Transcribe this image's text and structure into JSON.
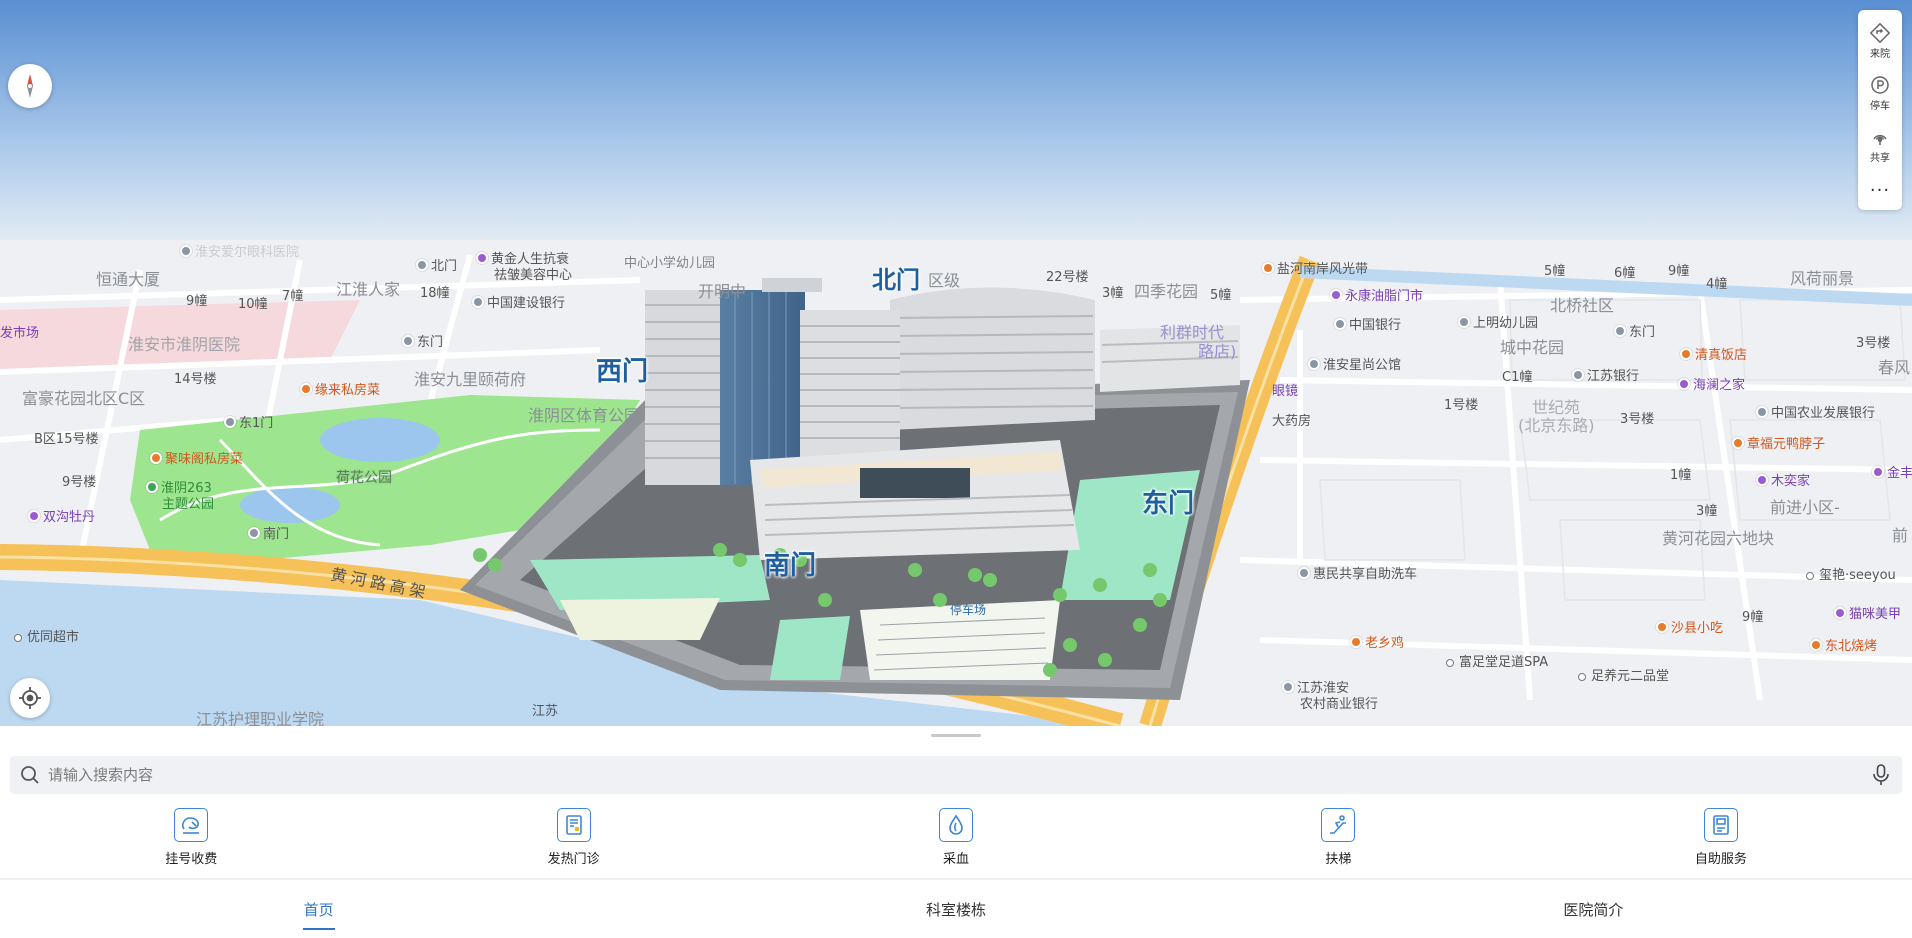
{
  "colors": {
    "accent": "#2f74c7",
    "icon_blue": "#3d86d6",
    "road_yellow": "#f5c158",
    "park_green": "#9ee58f",
    "water": "#bdd9f2"
  },
  "map": {
    "gates": {
      "north": "北门",
      "west": "西门",
      "south": "南门",
      "east": "东门",
      "parking": "停车场"
    },
    "roads": {
      "huanghe": "黄河路高架"
    },
    "labels": [
      {
        "text": "淮安爱尔眼科医院",
        "style": "faded"
      },
      {
        "text": "恒通大厦",
        "style": "big"
      },
      {
        "text": "北门"
      },
      {
        "text": "黄金人生抗衰"
      },
      {
        "text": "祛皱美容中心"
      },
      {
        "text": "中心小学幼儿园"
      },
      {
        "text": "开明中"
      },
      {
        "text": "江淮人家",
        "style": "big"
      },
      {
        "text": "9幢"
      },
      {
        "text": "10幢"
      },
      {
        "text": "7幢"
      },
      {
        "text": "18幢"
      },
      {
        "text": "中国建设银行"
      },
      {
        "text": "发市场",
        "style": "purple"
      },
      {
        "text": "淮安市淮阴医院",
        "style": "area"
      },
      {
        "text": "东门"
      },
      {
        "text": "14号楼"
      },
      {
        "text": "缘来私房菜",
        "style": "orange"
      },
      {
        "text": "淮安九里颐荷府",
        "style": "big"
      },
      {
        "text": "富豪花园北区C区",
        "style": "big"
      },
      {
        "text": "淮阴区体育公园",
        "style": "big"
      },
      {
        "text": "东1门"
      },
      {
        "text": "B区15号楼"
      },
      {
        "text": "聚味阁私房菜",
        "style": "orange"
      },
      {
        "text": "荷花公园",
        "style": "park"
      },
      {
        "text": "9号楼"
      },
      {
        "text": "淮阴263"
      },
      {
        "text": "主题公园"
      },
      {
        "text": "双沟牡丹",
        "style": "purple"
      },
      {
        "text": "南门"
      },
      {
        "text": "优同超市"
      },
      {
        "text": "江苏护理职业学院"
      },
      {
        "text": "江苏"
      },
      {
        "text": "区级"
      },
      {
        "text": "22号楼"
      },
      {
        "text": "3幢"
      },
      {
        "text": "四季花园",
        "style": "big"
      },
      {
        "text": "5幢"
      },
      {
        "text": "利群时代"
      },
      {
        "text": "路店)"
      },
      {
        "text": "眼镜"
      },
      {
        "text": "大药房"
      },
      {
        "text": "盐河南岸风光带"
      },
      {
        "text": "永康油脂门市",
        "style": "purple"
      },
      {
        "text": "中国银行"
      },
      {
        "text": "淮安星尚公馆"
      },
      {
        "text": "5幢"
      },
      {
        "text": "6幢"
      },
      {
        "text": "9幢"
      },
      {
        "text": "4幢"
      },
      {
        "text": "风荷丽景",
        "style": "big"
      },
      {
        "text": "北桥社区",
        "style": "big"
      },
      {
        "text": "上明幼儿园"
      },
      {
        "text": "东门"
      },
      {
        "text": "城中花园",
        "style": "big"
      },
      {
        "text": "清真饭店",
        "style": "orange"
      },
      {
        "text": "3号楼"
      },
      {
        "text": "C1幢"
      },
      {
        "text": "江苏银行"
      },
      {
        "text": "海澜之家",
        "style": "purple"
      },
      {
        "text": "春风",
        "style": "big"
      },
      {
        "text": "1号楼"
      },
      {
        "text": "世纪苑",
        "style": "area"
      },
      {
        "text": "(北京东路)",
        "style": "area"
      },
      {
        "text": "3号楼"
      },
      {
        "text": "中国农业发展银行"
      },
      {
        "text": "章福元鸭脖子",
        "style": "orange"
      },
      {
        "text": "1幢"
      },
      {
        "text": "木奕家",
        "style": "purple"
      },
      {
        "text": "金丰",
        "style": "purple"
      },
      {
        "text": "前进小区-",
        "style": "big"
      },
      {
        "text": "3幢"
      },
      {
        "text": "黄河花园六地块",
        "style": "big"
      },
      {
        "text": "前",
        "style": "big"
      },
      {
        "text": "惠民共享自助洗车"
      },
      {
        "text": "玺艳·seeyou"
      },
      {
        "text": "9幢"
      },
      {
        "text": "猫咪美甲",
        "style": "purple"
      },
      {
        "text": "沙县小吃",
        "style": "orange"
      },
      {
        "text": "老乡鸡",
        "style": "orange"
      },
      {
        "text": "东北烧烤",
        "style": "orange"
      },
      {
        "text": "富足堂足道SPA"
      },
      {
        "text": "足养元二品堂"
      },
      {
        "text": "江苏淮安"
      },
      {
        "text": "农村商业银行"
      }
    ]
  },
  "toolbox": [
    {
      "label": "来院",
      "icon": "route-icon"
    },
    {
      "label": "停车",
      "icon": "parking-icon"
    },
    {
      "label": "共享",
      "icon": "share-signal-icon"
    }
  ],
  "toolbox_more": "···",
  "search": {
    "placeholder": "请输入搜索内容"
  },
  "services": [
    {
      "label": "挂号收费",
      "icon": "registration-icon"
    },
    {
      "label": "发热门诊",
      "icon": "fever-clinic-icon"
    },
    {
      "label": "采血",
      "icon": "blood-drop-icon"
    },
    {
      "label": "扶梯",
      "icon": "escalator-icon"
    },
    {
      "label": "自助服务",
      "icon": "self-service-icon"
    }
  ],
  "tabs": [
    {
      "label": "首页",
      "active": true
    },
    {
      "label": "科室楼栋",
      "active": false
    },
    {
      "label": "医院简介",
      "active": false
    }
  ]
}
